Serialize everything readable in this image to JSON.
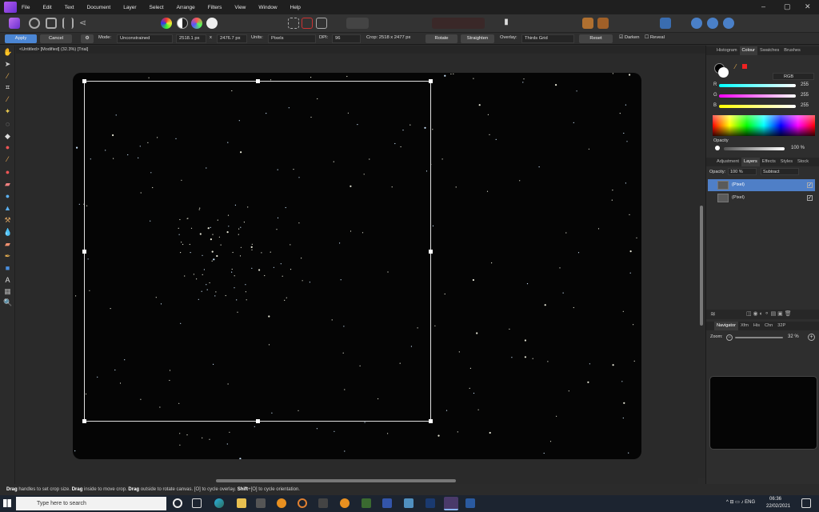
{
  "menu": [
    "File",
    "Edit",
    "Text",
    "Document",
    "Layer",
    "Select",
    "Arrange",
    "Filters",
    "View",
    "Window",
    "Help"
  ],
  "context": {
    "apply": "Apply",
    "cancel": "Cancel",
    "mode_label": "Mode:",
    "mode_value": "Unconstrained",
    "width": "2518.1 px",
    "x": "x",
    "height": "2476.7 px",
    "units_label": "Units:",
    "units_value": "Pixels",
    "dpi_label": "DPI:",
    "dpi_value": "96",
    "crop_info": "Crop:  2518 x 2477 px",
    "rotate": "Rotate",
    "straighten": "Straighten",
    "overlay_label": "Overlay:",
    "overlay_value": "Thirds Grid",
    "reset": "Reset",
    "darken": "Darken",
    "reveal": "Reveal"
  },
  "document_tab": "<Untitled> [Modified] (32.3%) [Trial]",
  "status": {
    "t1": "Drag",
    "t2": " handles to set crop size. ",
    "t3": "Drag",
    "t4": " inside to move crop. ",
    "t5": "Drag",
    "t6": " outside to rotate canvas. [O] to cycle overlay. ",
    "t7": "Shift",
    "t8": "+[O] to cycle orientation."
  },
  "colour_panel": {
    "tabs": [
      "Histogram",
      "Colour",
      "Swatches",
      "Brushes"
    ],
    "active_tab": "Colour",
    "model": "RGB",
    "channels": [
      {
        "label": "R",
        "value": "255"
      },
      {
        "label": "G",
        "value": "255"
      },
      {
        "label": "B",
        "value": "255"
      }
    ],
    "opacity_label": "Opacity",
    "opacity_value": "100 %"
  },
  "layers_panel": {
    "tabs": [
      "Adjustment",
      "Layers",
      "Effects",
      "Styles",
      "Stock"
    ],
    "active_tab": "Layers",
    "opacity_label": "Opacity:",
    "opacity_value": "100 %",
    "blend_mode": "Subtract",
    "layers": [
      {
        "name": "(Pixel)",
        "selected": true
      },
      {
        "name": "(Pixel)",
        "selected": false
      }
    ]
  },
  "navigator_panel": {
    "tabs": [
      "Navigator",
      "Xfm",
      "His",
      "Chn",
      "32P"
    ],
    "active_tab": "Navigator",
    "zoom_label": "Zoom:",
    "zoom_value": "32 %"
  },
  "taskbar": {
    "search_placeholder": "Type here to search",
    "time": "06:36",
    "date": "22/02/2021"
  },
  "colors": {
    "accent": "#4b86d4",
    "selected_layer": "#4f7fc7",
    "canvas_bg": "#050505"
  }
}
